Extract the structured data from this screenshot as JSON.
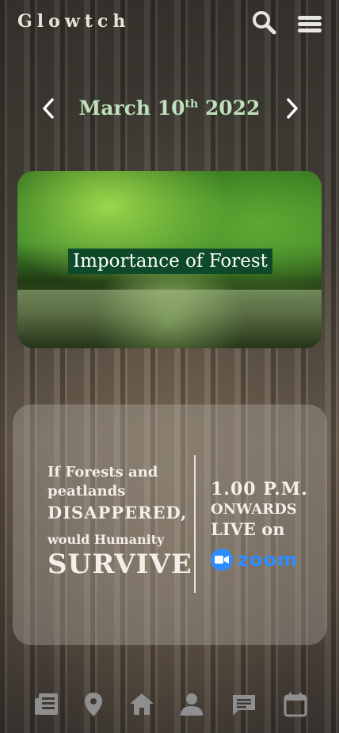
{
  "app": {
    "brand": "Glowtch"
  },
  "header": {
    "icons": [
      "search-icon",
      "hamburger-menu-icon"
    ]
  },
  "date": {
    "month_day": "March 10",
    "suffix": "th",
    "year": "2022"
  },
  "banner": {
    "title": "Importance of Forest"
  },
  "event": {
    "line1": "If Forests and",
    "line2": "peatlands",
    "line3": "DISAPPERED,",
    "line4": "would Humanity",
    "line5": "SURVIVE",
    "time": "1.00 P.M.",
    "onwards": "ONWARDS",
    "live": "LIVE on",
    "platform": "zoom"
  },
  "nav": {
    "items": [
      "news-icon",
      "location-icon",
      "home-icon",
      "profile-icon",
      "chat-icon",
      "calendar-icon"
    ]
  },
  "colors": {
    "accent": "#bfe0b8",
    "zoom": "#2d8cff",
    "icon": "#8f8f8f"
  }
}
